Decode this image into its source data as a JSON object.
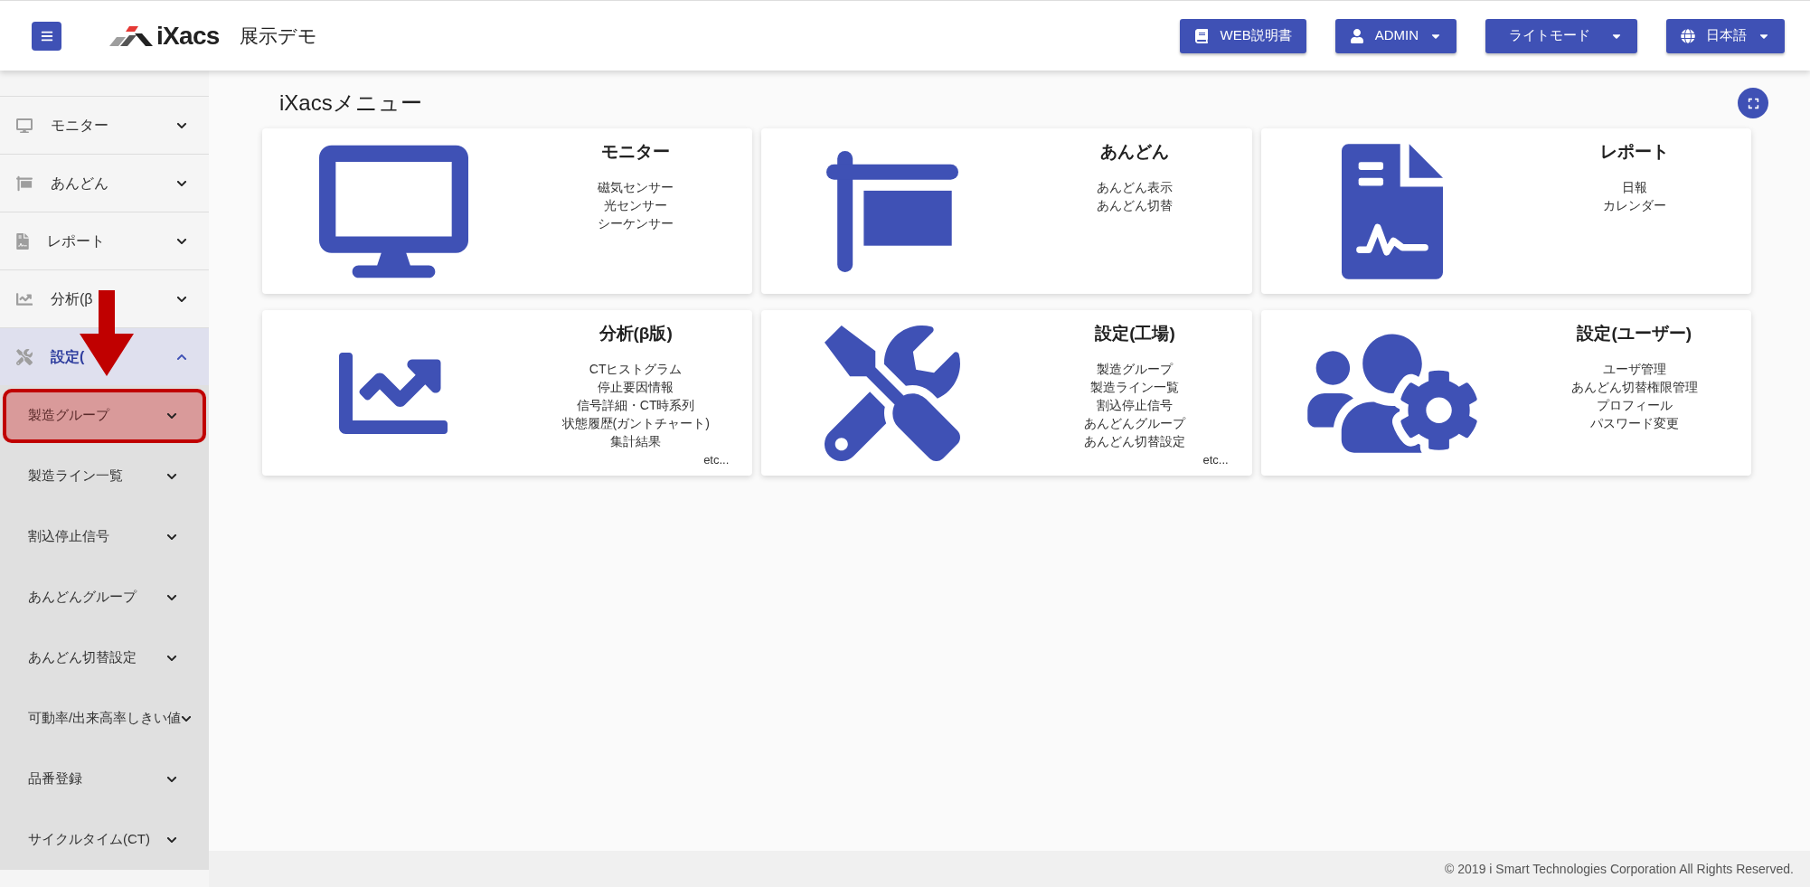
{
  "header": {
    "logo": "iXacs",
    "title": "展示デモ",
    "buttons": [
      {
        "label": "WEB説明書",
        "kind": "link"
      },
      {
        "label": "ADMIN",
        "kind": "menu"
      },
      {
        "label": "ライトモード",
        "kind": "menu"
      },
      {
        "label": "日本語",
        "kind": "menu"
      }
    ]
  },
  "sidebar": {
    "items": [
      {
        "label": "モニター",
        "expanded": false
      },
      {
        "label": "あんどん",
        "expanded": false
      },
      {
        "label": "レポート",
        "expanded": false
      },
      {
        "label": "分析(β",
        "expanded": false
      },
      {
        "label": "設定(",
        "expanded": true,
        "children": [
          {
            "label": "製造グループ",
            "highlighted": true
          },
          {
            "label": "製造ライン一覧",
            "highlighted": false
          },
          {
            "label": "割込停止信号",
            "highlighted": false
          },
          {
            "label": "あんどんグループ",
            "highlighted": false
          },
          {
            "label": "あんどん切替設定",
            "highlighted": false
          },
          {
            "label": "可動率/出来高率しきい値",
            "highlighted": false
          },
          {
            "label": "品番登録",
            "highlighted": false
          },
          {
            "label": "サイクルタイム(CT)",
            "highlighted": false
          }
        ]
      }
    ]
  },
  "main": {
    "title": "iXacsメニュー",
    "cards": [
      {
        "title": "モニター",
        "items": [
          "磁気センサー",
          "光センサー",
          "シーケンサー"
        ]
      },
      {
        "title": "あんどん",
        "items": [
          "あんどん表示",
          "あんどん切替"
        ]
      },
      {
        "title": "レポート",
        "items": [
          "日報",
          "カレンダー"
        ]
      },
      {
        "title": "分析(β版)",
        "items": [
          "CTヒストグラム",
          "停止要因情報",
          "信号詳細・CT時系列",
          "状態履歴(ガントチャート)",
          "集計結果"
        ],
        "more": "etc..."
      },
      {
        "title": "設定(工場)",
        "items": [
          "製造グループ",
          "製造ライン一覧",
          "割込停止信号",
          "あんどんグループ",
          "あんどん切替設定"
        ],
        "more": "etc..."
      },
      {
        "title": "設定(ユーザー)",
        "items": [
          "ユーザ管理",
          "あんどん切替権限管理",
          "プロフィール",
          "パスワード変更"
        ]
      }
    ]
  },
  "footer": "© 2019 i Smart Technologies Corporation All Rights Reserved."
}
